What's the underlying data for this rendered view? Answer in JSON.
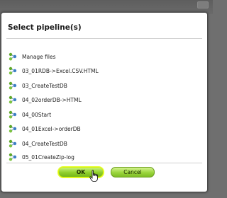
{
  "dialog": {
    "title": "Select pipeline(s)",
    "close_symbol": "×"
  },
  "items": [
    {
      "label": "Manage files",
      "icon": "pipeline-icon"
    },
    {
      "label": "03_01RDB->Excel.CSV.HTML",
      "icon": "pipeline-icon"
    },
    {
      "label": "03_CreateTestDB",
      "icon": "pipeline-icon"
    },
    {
      "label": "04_02orderDB->HTML",
      "icon": "pipeline-icon"
    },
    {
      "label": "04_00Start",
      "icon": "pipeline-icon"
    },
    {
      "label": "04_01Excel->orderDB",
      "icon": "pipeline-icon"
    },
    {
      "label": "04_CreateTestDB",
      "icon": "pipeline-icon"
    },
    {
      "label": "05_01CreateZip-log",
      "icon": "pipeline-icon"
    }
  ],
  "buttons": {
    "ok_label": "OK",
    "cancel_label": "Cancel"
  },
  "colors": {
    "button_green": "#8fcf2a",
    "ok_highlight": "#e7ff3a",
    "overlay": "#6f6f6f"
  }
}
